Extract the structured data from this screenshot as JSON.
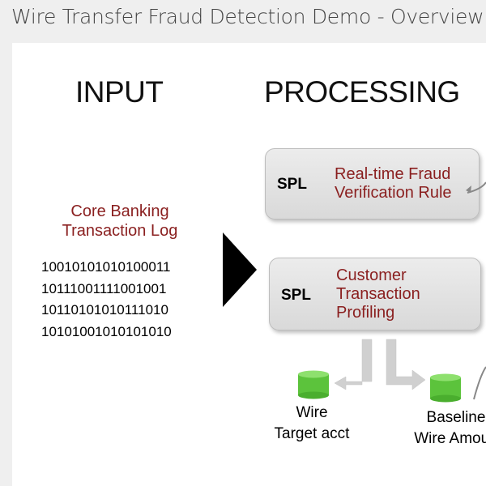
{
  "window": {
    "title": "Wire Transfer Fraud Detection Demo - Overview"
  },
  "slide": {
    "input_heading": "INPUT",
    "processing_heading": "PROCESSING",
    "core_banking": {
      "line1": "Core Banking",
      "line2": "Transaction Log"
    },
    "binary_lines": [
      "10010101010100011",
      "10111001111001001",
      "10110101010111010",
      "10101001010101010"
    ],
    "spl_boxes": [
      {
        "tag": "SPL",
        "line1": "Real-time Fraud",
        "line2": "Verification Rule",
        "line3": ""
      },
      {
        "tag": "SPL",
        "line1": "Customer",
        "line2": "Transaction",
        "line3": "Profiling"
      }
    ],
    "databases": [
      {
        "line1": "Wire",
        "line2": "Target acct"
      },
      {
        "line1": "Baseline",
        "line2": "Wire Amoun"
      }
    ]
  },
  "colors": {
    "accent_text": "#8a1f1f",
    "db_green": "#5cc33c",
    "box_gray": "#e3e3e3"
  }
}
